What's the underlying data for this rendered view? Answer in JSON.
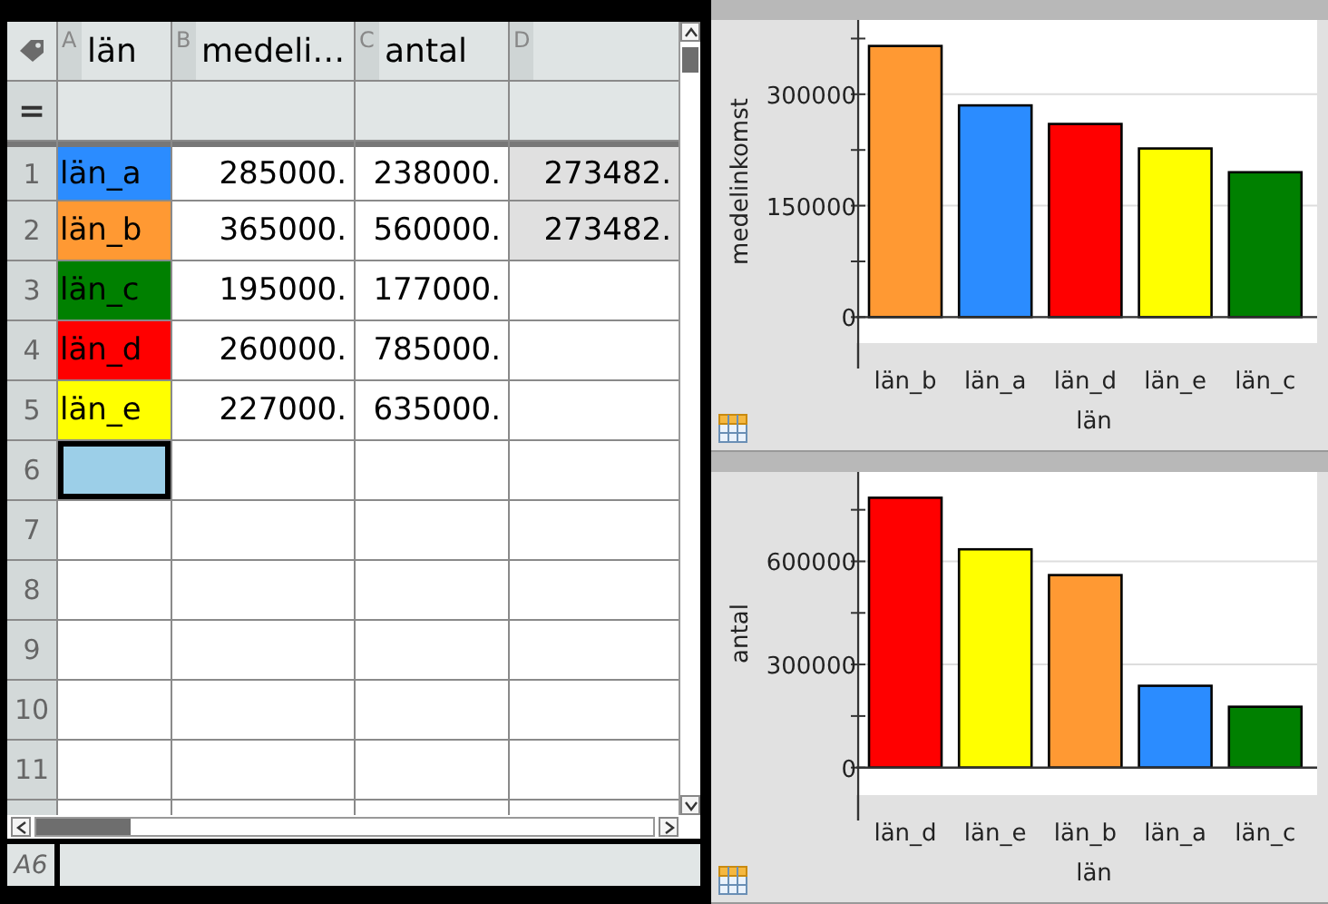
{
  "spreadsheet": {
    "columns": [
      {
        "letter": "A",
        "name": "län"
      },
      {
        "letter": "B",
        "name": "medeli…"
      },
      {
        "letter": "C",
        "name": "antal"
      },
      {
        "letter": "D"
      }
    ],
    "formula_row_label": "=",
    "rows": [
      {
        "label": "1",
        "cells": [
          {
            "text": "län_a",
            "color": "#2b8cff",
            "selected": false,
            "computed": false
          },
          {
            "text": "285000.",
            "selected": false,
            "computed": false
          },
          {
            "text": "238000.",
            "selected": false,
            "computed": false
          },
          {
            "text": "273482.",
            "selected": false,
            "computed": true
          }
        ]
      },
      {
        "label": "2",
        "cells": [
          {
            "text": "län_b",
            "color": "#ff9933",
            "selected": false,
            "computed": false
          },
          {
            "text": "365000.",
            "selected": false,
            "computed": false
          },
          {
            "text": "560000.",
            "selected": false,
            "computed": false
          },
          {
            "text": "273482.",
            "selected": false,
            "computed": true
          }
        ]
      },
      {
        "label": "3",
        "cells": [
          {
            "text": "län_c",
            "color": "#008000",
            "selected": false,
            "computed": false
          },
          {
            "text": "195000.",
            "selected": false,
            "computed": false
          },
          {
            "text": "177000.",
            "selected": false,
            "computed": false
          },
          {
            "selected": false,
            "computed": false
          }
        ]
      },
      {
        "label": "4",
        "cells": [
          {
            "text": "län_d",
            "color": "#ff0000",
            "selected": false,
            "computed": false
          },
          {
            "text": "260000.",
            "selected": false,
            "computed": false
          },
          {
            "text": "785000.",
            "selected": false,
            "computed": false
          },
          {
            "selected": false,
            "computed": false
          }
        ]
      },
      {
        "label": "5",
        "cells": [
          {
            "text": "län_e",
            "color": "#ffff00",
            "selected": false,
            "computed": false
          },
          {
            "text": "227000.",
            "selected": false,
            "computed": false
          },
          {
            "text": "635000.",
            "selected": false,
            "computed": false
          },
          {
            "selected": false,
            "computed": false
          }
        ]
      },
      {
        "label": "6",
        "cells": [
          {
            "selected": true,
            "computed": false
          },
          {
            "selected": false,
            "computed": false
          },
          {
            "selected": false,
            "computed": false
          },
          {
            "selected": false,
            "computed": false
          }
        ]
      },
      {
        "label": "7",
        "cells": [
          {
            "selected": false,
            "computed": false
          },
          {
            "selected": false,
            "computed": false
          },
          {
            "selected": false,
            "computed": false
          },
          {
            "selected": false,
            "computed": false
          }
        ]
      },
      {
        "label": "8",
        "cells": [
          {
            "selected": false,
            "computed": false
          },
          {
            "selected": false,
            "computed": false
          },
          {
            "selected": false,
            "computed": false
          },
          {
            "selected": false,
            "computed": false
          }
        ]
      },
      {
        "label": "9",
        "cells": [
          {
            "selected": false,
            "computed": false
          },
          {
            "selected": false,
            "computed": false
          },
          {
            "selected": false,
            "computed": false
          },
          {
            "selected": false,
            "computed": false
          }
        ]
      },
      {
        "label": "10",
        "cells": [
          {
            "selected": false,
            "computed": false
          },
          {
            "selected": false,
            "computed": false
          },
          {
            "selected": false,
            "computed": false
          },
          {
            "selected": false,
            "computed": false
          }
        ]
      },
      {
        "label": "11",
        "cells": [
          {
            "selected": false,
            "computed": false
          },
          {
            "selected": false,
            "computed": false
          },
          {
            "selected": false,
            "computed": false
          },
          {
            "selected": false,
            "computed": false
          }
        ]
      }
    ]
  },
  "entry_line": {
    "cell_ref": "A6"
  },
  "charts": [
    {
      "chart_data": {
        "type": "bar",
        "xlabel": "län",
        "ylabel": "medelinkomst",
        "categories": [
          "län_b",
          "län_a",
          "län_d",
          "län_e",
          "län_c"
        ],
        "series": [
          {
            "values": [
              365000,
              285000,
              260000,
              227000,
              195000
            ],
            "colors": [
              "#ff9933",
              "#2b8cff",
              "#ff0000",
              "#ffff00",
              "#008000"
            ]
          }
        ],
        "ylim": [
          -35000,
          400000
        ],
        "yticks": [
          0,
          150000,
          300000
        ],
        "grid": true
      }
    },
    {
      "chart_data": {
        "type": "bar",
        "xlabel": "län",
        "ylabel": "antal",
        "categories": [
          "län_d",
          "län_e",
          "län_b",
          "län_a",
          "län_c"
        ],
        "series": [
          {
            "values": [
              785000,
              635000,
              560000,
              238000,
              177000
            ],
            "colors": [
              "#ff0000",
              "#ffff00",
              "#ff9933",
              "#2b8cff",
              "#008000"
            ]
          }
        ],
        "ylim": [
          -80000,
          860000
        ],
        "yticks": [
          0,
          300000,
          600000
        ],
        "grid": true
      }
    }
  ]
}
